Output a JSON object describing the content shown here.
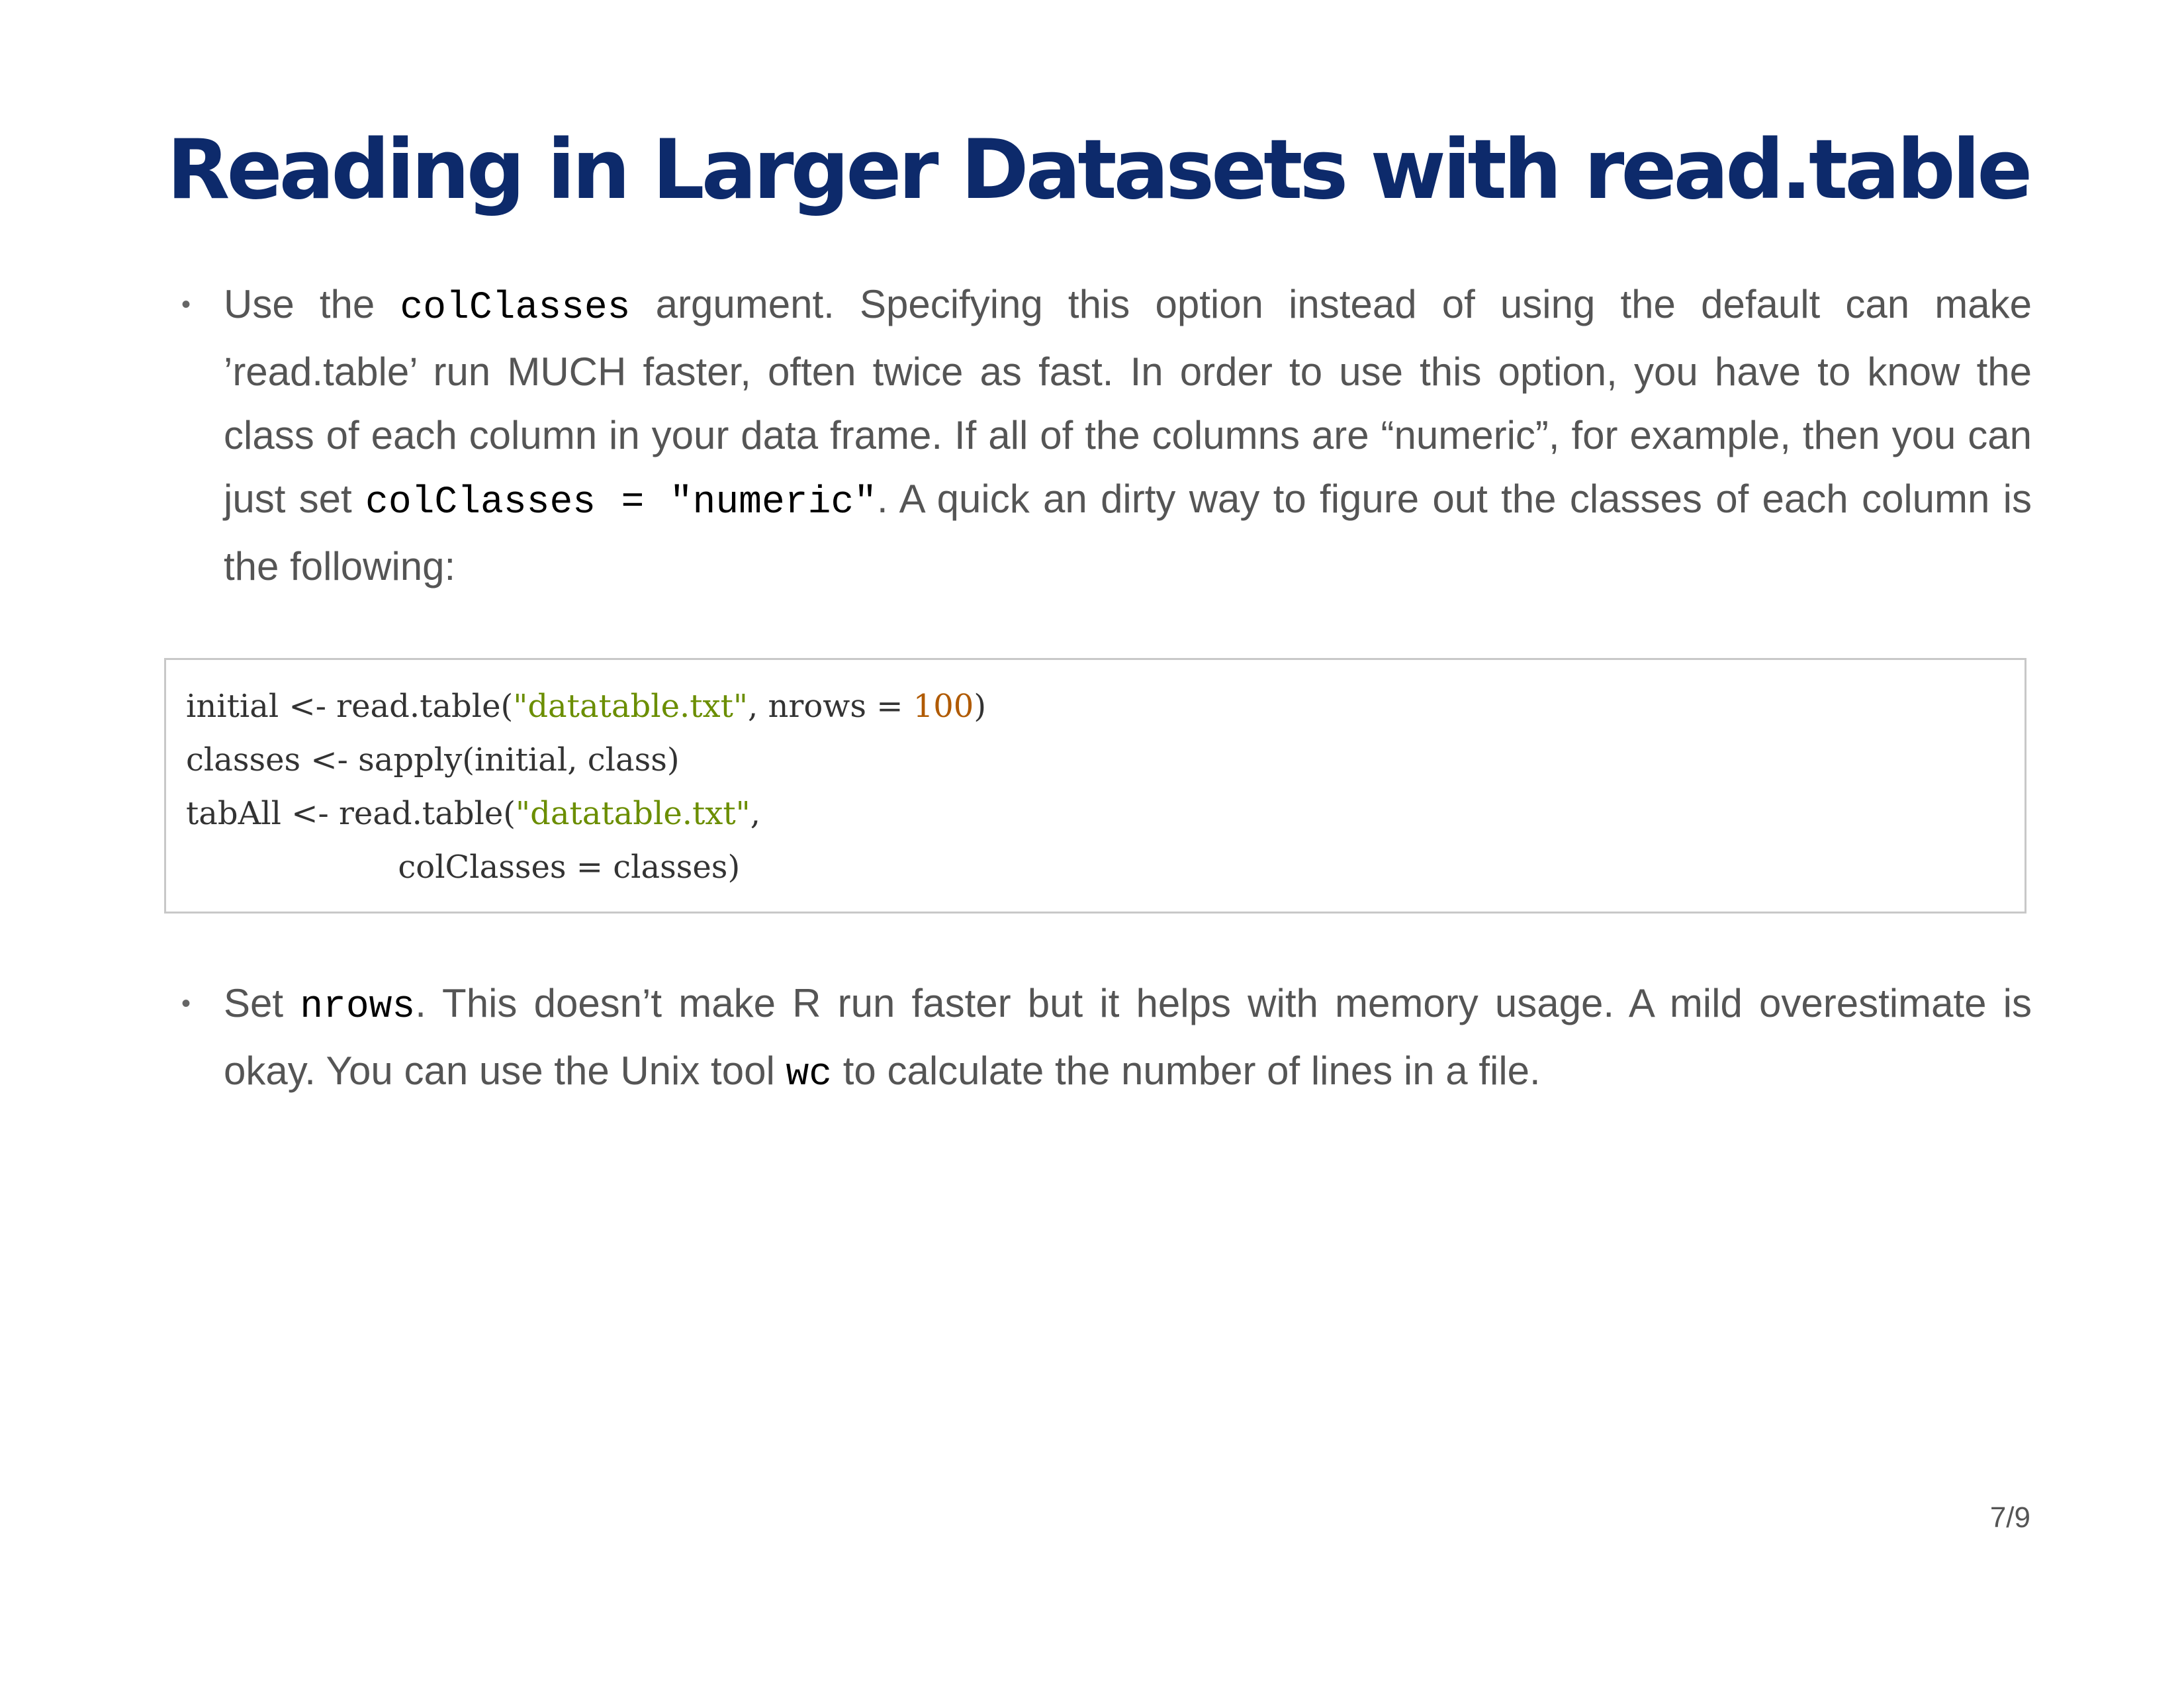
{
  "slide": {
    "title": "Reading in Larger Datasets with read.table",
    "page_number": "7/9",
    "bullet_1": {
      "text_1": "Use the ",
      "code_1": "colClasses",
      "text_2": " argument. Specifying this option instead of using the default can make ’read.table’ run MUCH faster, often twice as fast. In order to use this option, you have to know the class of each column in your data frame. If all of the columns are “numeric”, for example, then you can just set ",
      "code_2": "colClasses = \"numeric\"",
      "text_3": ". A quick an dirty way to figure out the classes of each column is the following:"
    },
    "code_block": {
      "line_1_a": "initial <- read.table(",
      "line_1_str": "\"datatable.txt\"",
      "line_1_b": ", nrows = ",
      "line_1_num": "100",
      "line_1_c": ")",
      "line_2": "classes <- sapply(initial, class)",
      "line_3_a": "tabAll <- read.table(",
      "line_3_str": "\"datatable.txt\"",
      "line_3_b": ",",
      "line_4": "                     colClasses = classes)"
    },
    "bullet_2": {
      "text_1": "Set ",
      "code_1": "nrows",
      "text_2": ". This doesn’t make R run faster but it helps with memory usage. A mild overestimate is okay. You can use the Unix tool ",
      "code_2": "wc",
      "text_3": " to calculate the number of lines in a file."
    }
  }
}
